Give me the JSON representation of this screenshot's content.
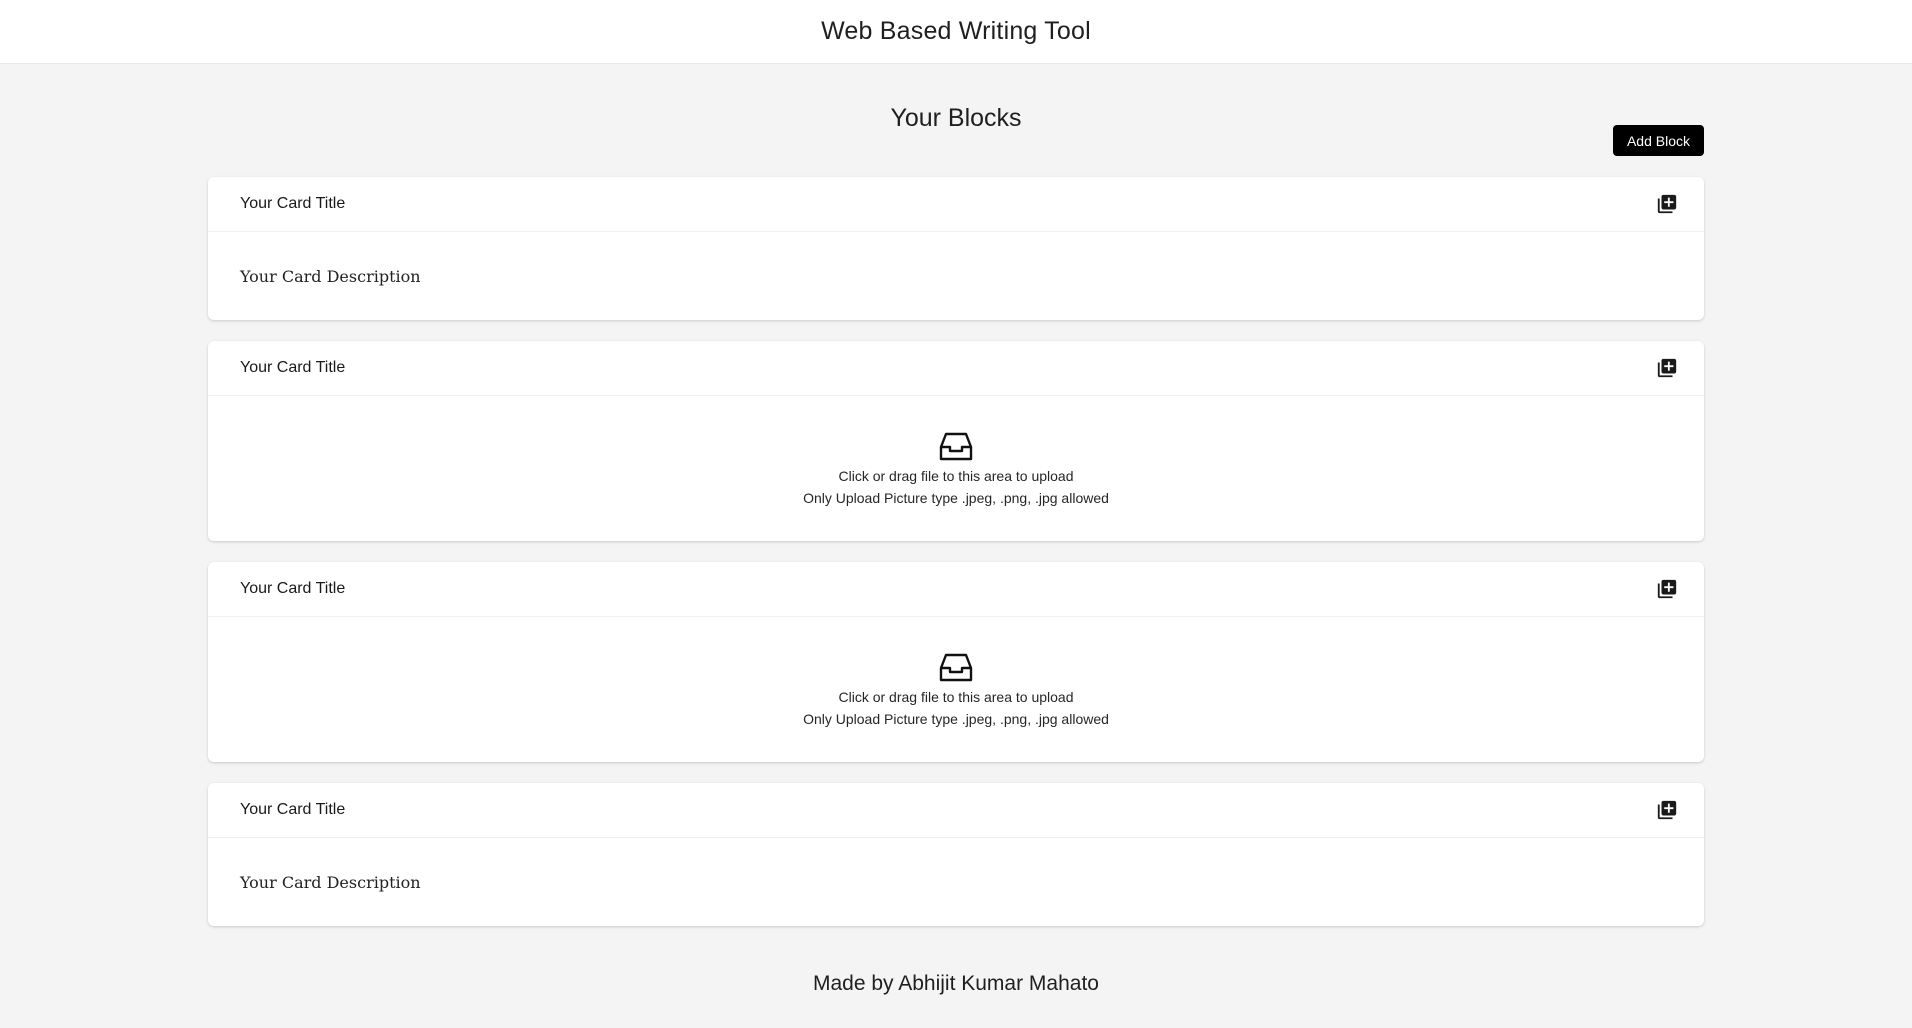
{
  "header": {
    "title": "Web Based Writing Tool"
  },
  "main": {
    "section_title": "Your Blocks",
    "add_block_label": "Add Block"
  },
  "cards": [
    {
      "title": "Your Card Title",
      "type": "text",
      "description": "Your Card Description",
      "action_icon": "add-copy-icon"
    },
    {
      "title": "Your Card Title",
      "type": "upload",
      "upload_text": "Click or drag file to this area to upload",
      "upload_hint": "Only Upload Picture type .jpeg, .png, .jpg allowed",
      "upload_icon": "inbox-icon",
      "action_icon": "add-copy-icon"
    },
    {
      "title": "Your Card Title",
      "type": "upload",
      "upload_text": "Click or drag file to this area to upload",
      "upload_hint": "Only Upload Picture type .jpeg, .png, .jpg allowed",
      "upload_icon": "inbox-icon",
      "action_icon": "add-copy-icon"
    },
    {
      "title": "Your Card Title",
      "type": "text",
      "description": "Your Card Description",
      "action_icon": "add-copy-icon"
    }
  ],
  "footer": {
    "text": "Made by Abhijit Kumar Mahato"
  },
  "colors": {
    "background": "#f4f4f4",
    "card": "#ffffff",
    "button": "#000000",
    "button_text": "#ffffff"
  }
}
